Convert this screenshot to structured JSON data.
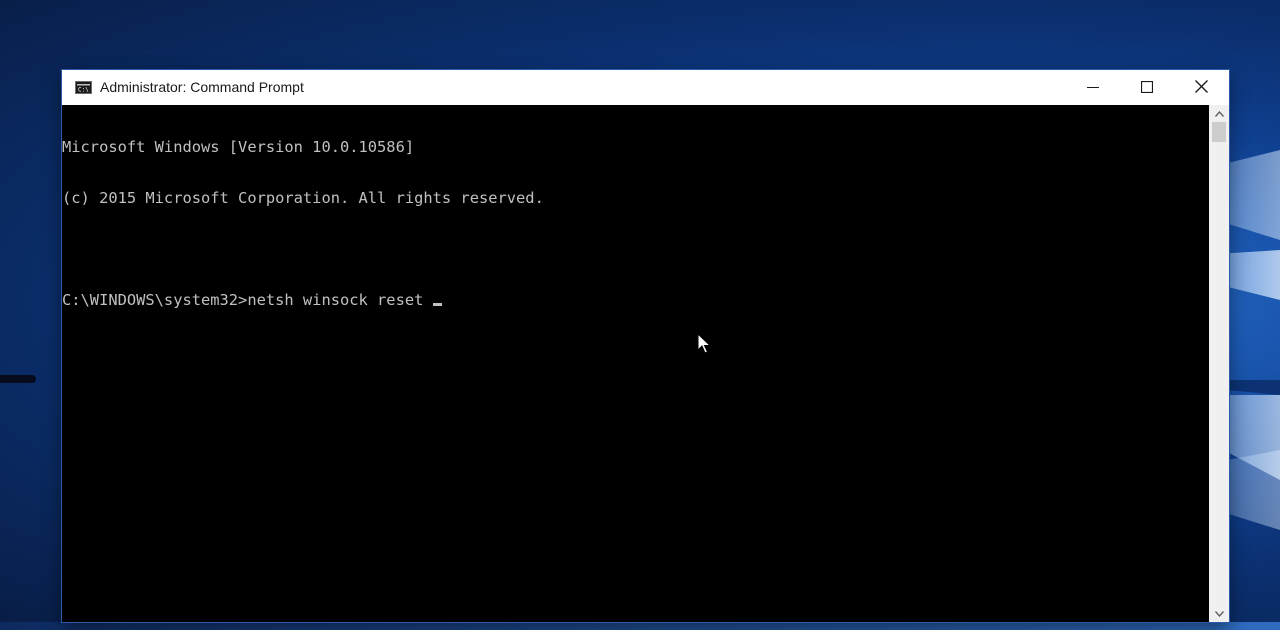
{
  "window": {
    "title": "Administrator: Command Prompt",
    "app_icon": "cmd-icon",
    "controls": {
      "minimize": "minimize-icon",
      "maximize": "maximize-icon",
      "close": "close-icon"
    }
  },
  "console": {
    "lines": [
      "Microsoft Windows [Version 10.0.10586]",
      "(c) 2015 Microsoft Corporation. All rights reserved.",
      "",
      "C:\\WINDOWS\\system32>netsh winsock reset "
    ],
    "text_color": "#c0c0c0",
    "background": "#000000"
  },
  "colors": {
    "desktop_accent": "#1d5bb5",
    "title_bar": "#ffffff"
  }
}
